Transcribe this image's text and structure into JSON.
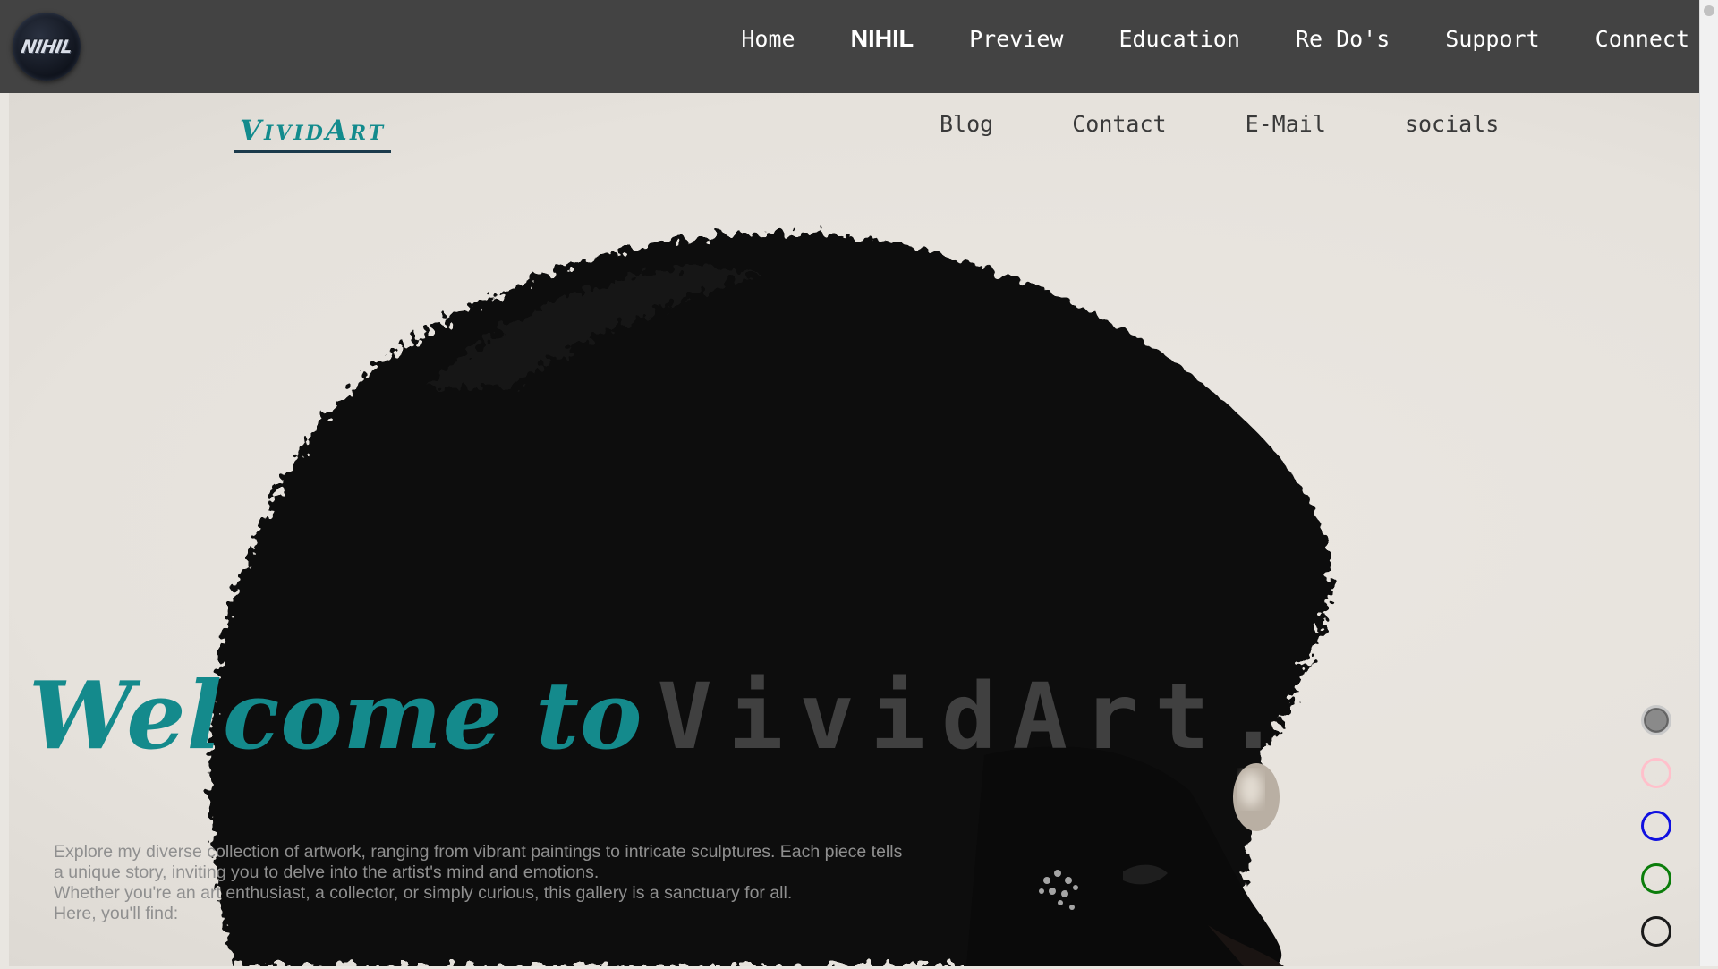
{
  "topbar": {
    "logo_text": "NIHIL",
    "nav": [
      "Home",
      "NIHIL",
      "Preview",
      "Education",
      "Re Do's",
      "Support",
      "Connect"
    ]
  },
  "site": {
    "brand": "VividArt",
    "subnav": [
      "Blog",
      "Contact",
      "E-Mail",
      "socials"
    ]
  },
  "hero": {
    "headline_welcome": "Welcome to",
    "headline_brand": "VividArt.",
    "intro_lines": [
      "Explore my diverse collection of artwork, ranging from vibrant paintings to intricate sculptures. Each piece tells",
      "a unique story, inviting you to delve into the artist's mind and emotions.",
      "Whether you're an art enthusiast, a collector, or simply curious, this gallery is a sanctuary for all.",
      "Here, you'll find:"
    ]
  },
  "theme_dots": [
    {
      "color": "#8a8a8a",
      "selected": true
    },
    {
      "color": "#ffc0cb",
      "selected": false
    },
    {
      "color": "#1010e0",
      "selected": false
    },
    {
      "color": "#0b7d0b",
      "selected": false
    },
    {
      "color": "#1a1a1a",
      "selected": false
    }
  ]
}
